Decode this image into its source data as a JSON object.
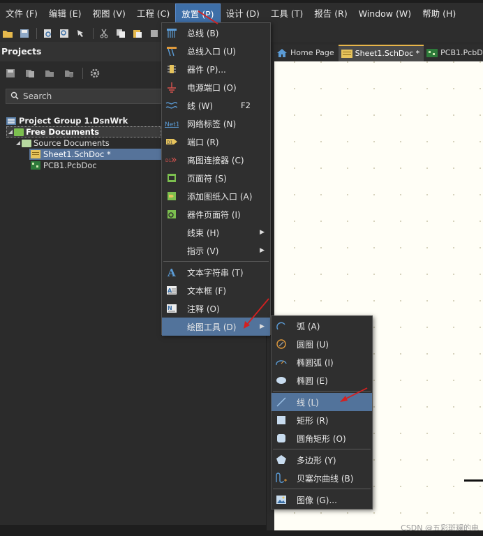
{
  "menubar": {
    "items": [
      "文件 (F)",
      "编辑 (E)",
      "视图 (V)",
      "工程 (C)",
      "放置 (P)",
      "设计 (D)",
      "工具 (T)",
      "报告 (R)",
      "Window (W)",
      "帮助 (H)"
    ]
  },
  "projects_panel": {
    "title": "Projects",
    "search_placeholder": "Search",
    "tree": {
      "project_group": "Project Group 1.DsnWrk",
      "free_documents": "Free Documents",
      "source_documents": "Source Documents",
      "sheet": "Sheet1.SchDoc *",
      "pcb": "PCB1.PcbDoc"
    }
  },
  "doc_tabs": [
    "Home Page",
    "Sheet1.SchDoc *",
    "PCB1.PcbDoc"
  ],
  "place_menu": {
    "items": [
      {
        "label": "总线 (B)",
        "icon": "bus-icon"
      },
      {
        "label": "总线入口 (U)",
        "icon": "bus-entry-icon"
      },
      {
        "label": "器件 (P)...",
        "icon": "part-icon"
      },
      {
        "label": "电源端口 (O)",
        "icon": "power-port-icon"
      },
      {
        "label": "线 (W)",
        "icon": "wire-icon",
        "shortcut": "F2"
      },
      {
        "label": "网络标签 (N)",
        "icon": "net-label-icon"
      },
      {
        "label": "端口 (R)",
        "icon": "port-icon"
      },
      {
        "label": "离图连接器 (C)",
        "icon": "off-sheet-connector-icon"
      },
      {
        "label": "页面符 (S)",
        "icon": "sheet-symbol-icon"
      },
      {
        "label": "添加图纸入口 (A)",
        "icon": "sheet-entry-icon"
      },
      {
        "label": "器件页面符 (I)",
        "icon": "device-sheet-symbol-icon"
      },
      {
        "label": "线束 (H)",
        "icon": "",
        "submenu": true
      },
      {
        "label": "指示 (V)",
        "icon": "",
        "submenu": true
      },
      {
        "label": "文本字符串 (T)",
        "icon": "text-string-icon"
      },
      {
        "label": "文本框 (F)",
        "icon": "text-frame-icon"
      },
      {
        "label": "注释 (O)",
        "icon": "note-icon"
      },
      {
        "label": "绘图工具 (D)",
        "icon": "",
        "submenu": true
      }
    ]
  },
  "draw_menu": {
    "items": [
      {
        "label": "弧 (A)",
        "icon": "arc-icon"
      },
      {
        "label": "圆圈 (U)",
        "icon": "circle-icon"
      },
      {
        "label": "椭圆弧 (I)",
        "icon": "elliptical-arc-icon"
      },
      {
        "label": "椭圆 (E)",
        "icon": "ellipse-icon"
      },
      {
        "label": "线 (L)",
        "icon": "line-icon"
      },
      {
        "label": "矩形 (R)",
        "icon": "rectangle-icon"
      },
      {
        "label": "圆角矩形 (O)",
        "icon": "round-rectangle-icon"
      },
      {
        "label": "多边形 (Y)",
        "icon": "polygon-icon"
      },
      {
        "label": "贝塞尔曲线 (B)",
        "icon": "bezier-icon"
      },
      {
        "label": "图像 (G)...",
        "icon": "image-icon"
      }
    ]
  },
  "watermark": "CSDN @五彩斑斓的电",
  "colors": {
    "active_menu": "#3e6fa8",
    "highlight": "#52739b",
    "canvas": "#fffef6",
    "annotation_arrow": "#d42020"
  }
}
